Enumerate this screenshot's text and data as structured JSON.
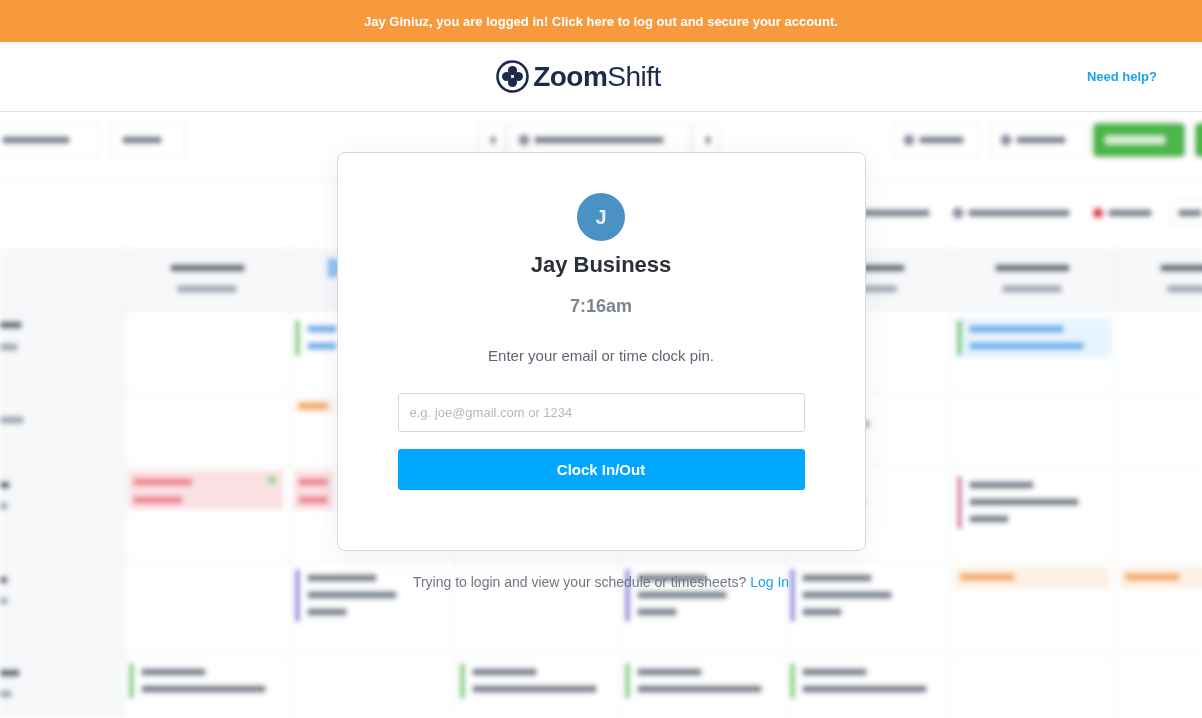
{
  "banner": {
    "text": "Jay Giniuz, you are logged in! Click here to log out and secure your account."
  },
  "header": {
    "logo": "**Zoom**Shift",
    "help_link": "Need help?"
  },
  "clock_in_dialog": {
    "avatar_initial": "J",
    "name": "Jay Business",
    "time": "7:16am",
    "prompt": "Enter your email or time clock pin.",
    "input": {
      "placeholder": "e.g. joe@gmail.com or 1234"
    },
    "submit_button": "Clock In/Out"
  },
  "login_hint": {
    "text": "Trying to login and view your schedule or timesheets?",
    "link": "Log In"
  }
}
